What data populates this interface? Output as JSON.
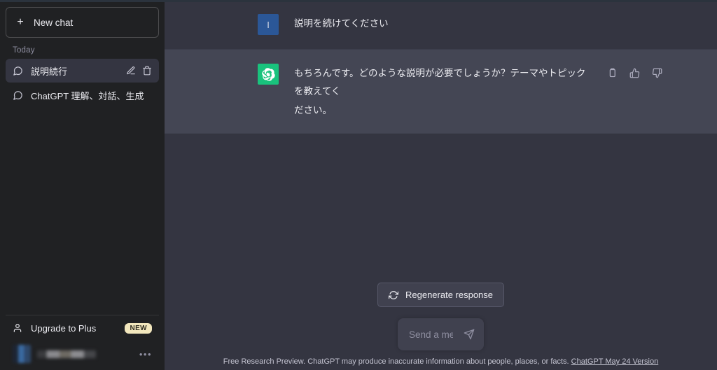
{
  "sidebar": {
    "new_chat_label": "New chat",
    "section_label": "Today",
    "chats": [
      {
        "title": "説明続行",
        "active": true
      },
      {
        "title": "ChatGPT 理解、対話、生成",
        "active": false
      }
    ],
    "upgrade_label": "Upgrade to Plus",
    "new_badge": "NEW",
    "user_menu_dots": "•••"
  },
  "conversation": {
    "messages": [
      {
        "role": "user",
        "avatar_letter": "I",
        "lines": [
          "説明を続けてください"
        ]
      },
      {
        "role": "assistant",
        "lines": [
          "もちろんです。どのような説明が必要でしょうか？テーマやトピックを教えてく",
          "ださい。"
        ]
      }
    ]
  },
  "composer": {
    "regenerate_label": "Regenerate response",
    "input_value": "",
    "input_placeholder": "Send a message...",
    "footer_text": "Free Research Preview. ChatGPT may produce inaccurate information about people, places, or facts.",
    "footer_link": "ChatGPT May 24 Version"
  },
  "colors": {
    "sidebar_bg": "#202123",
    "user_row_bg": "#343541",
    "assistant_row_bg": "#444654",
    "user_avatar": "#2b5797",
    "bot_avatar": "#19c37d",
    "badge_bg": "#f2e7bd"
  }
}
